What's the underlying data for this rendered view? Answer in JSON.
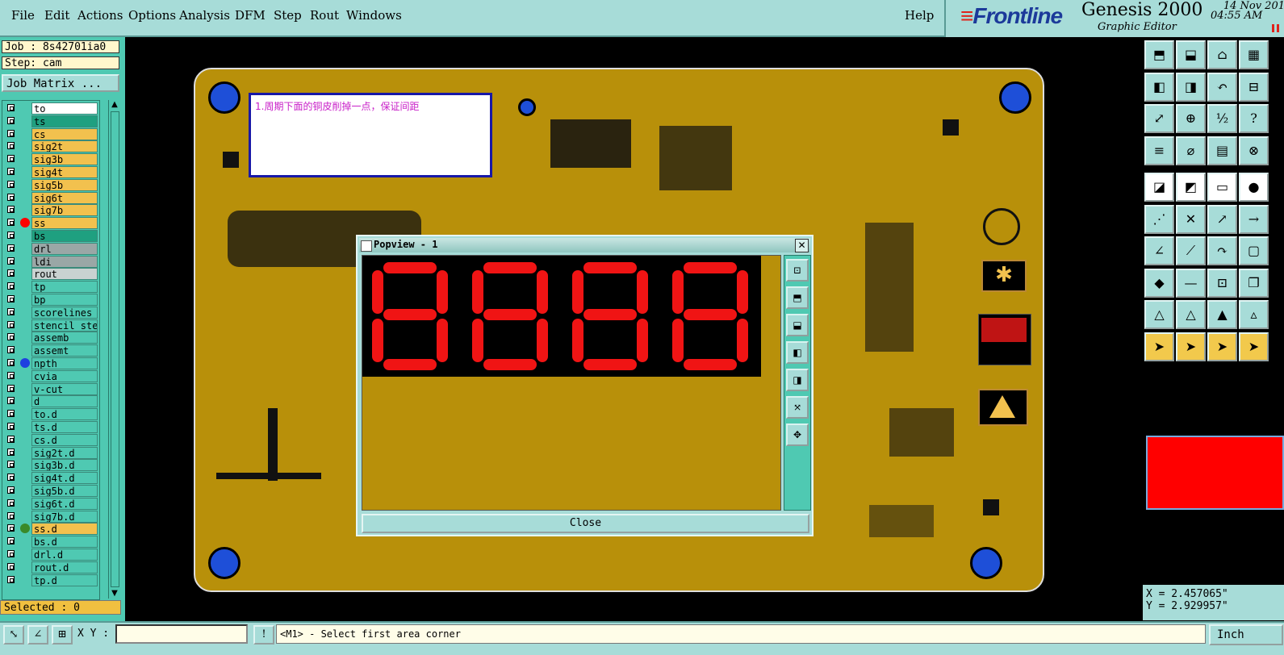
{
  "menu": [
    "File",
    "Edit",
    "Actions",
    "Options",
    "Analysis",
    "DFM",
    "Step",
    "Rout",
    "Windows"
  ],
  "help_label": "Help",
  "brand": {
    "logo": "Frontline",
    "product": "Genesis 2000",
    "subtitle": "Graphic Editor",
    "date": "14 Nov 201",
    "time": "04:55 AM"
  },
  "job": {
    "job_label": "Job : 8s42701ia0",
    "step_label": "Step: cam",
    "matrix_button": "Job Matrix ..."
  },
  "layers": [
    {
      "name": "to",
      "color": "#ffffff",
      "dot": ""
    },
    {
      "name": "ts",
      "color": "#1fa080",
      "dot": ""
    },
    {
      "name": "cs",
      "color": "#f2c14e",
      "dot": ""
    },
    {
      "name": "sig2t",
      "color": "#f2c14e",
      "dot": ""
    },
    {
      "name": "sig3b",
      "color": "#f2c14e",
      "dot": ""
    },
    {
      "name": "sig4t",
      "color": "#f2c14e",
      "dot": ""
    },
    {
      "name": "sig5b",
      "color": "#f2c14e",
      "dot": ""
    },
    {
      "name": "sig6t",
      "color": "#f2c14e",
      "dot": ""
    },
    {
      "name": "sig7b",
      "color": "#f2c14e",
      "dot": ""
    },
    {
      "name": "ss",
      "color": "#f2c14e",
      "dot": "#ff0000"
    },
    {
      "name": "bs",
      "color": "#1fa080",
      "dot": ""
    },
    {
      "name": "drl",
      "color": "#9aa7a6",
      "dot": ""
    },
    {
      "name": "ldi",
      "color": "#9aa7a6",
      "dot": ""
    },
    {
      "name": "rout",
      "color": "#c9d2d1",
      "dot": ""
    },
    {
      "name": "tp",
      "color": "#4fc9b2",
      "dot": ""
    },
    {
      "name": "bp",
      "color": "#4fc9b2",
      "dot": ""
    },
    {
      "name": "scorelines",
      "color": "#4fc9b2",
      "dot": ""
    },
    {
      "name": "stencil_ste",
      "color": "#4fc9b2",
      "dot": ""
    },
    {
      "name": "assemb",
      "color": "#4fc9b2",
      "dot": ""
    },
    {
      "name": "assemt",
      "color": "#4fc9b2",
      "dot": ""
    },
    {
      "name": "npth",
      "color": "#4fc9b2",
      "dot": "#1e3fe0"
    },
    {
      "name": "cvia",
      "color": "#4fc9b2",
      "dot": ""
    },
    {
      "name": "v-cut",
      "color": "#4fc9b2",
      "dot": ""
    },
    {
      "name": "d",
      "color": "#4fc9b2",
      "dot": ""
    },
    {
      "name": "to.d",
      "color": "#4fc9b2",
      "dot": ""
    },
    {
      "name": "ts.d",
      "color": "#4fc9b2",
      "dot": ""
    },
    {
      "name": "cs.d",
      "color": "#4fc9b2",
      "dot": ""
    },
    {
      "name": "sig2t.d",
      "color": "#4fc9b2",
      "dot": ""
    },
    {
      "name": "sig3b.d",
      "color": "#4fc9b2",
      "dot": ""
    },
    {
      "name": "sig4t.d",
      "color": "#4fc9b2",
      "dot": ""
    },
    {
      "name": "sig5b.d",
      "color": "#4fc9b2",
      "dot": ""
    },
    {
      "name": "sig6t.d",
      "color": "#4fc9b2",
      "dot": ""
    },
    {
      "name": "sig7b.d",
      "color": "#4fc9b2",
      "dot": ""
    },
    {
      "name": "ss.d",
      "color": "#f2c14e",
      "dot": "#3a8a2a"
    },
    {
      "name": "bs.d",
      "color": "#4fc9b2",
      "dot": ""
    },
    {
      "name": "drl.d",
      "color": "#4fc9b2",
      "dot": ""
    },
    {
      "name": "rout.d",
      "color": "#4fc9b2",
      "dot": ""
    },
    {
      "name": "tp.d",
      "color": "#4fc9b2",
      "dot": ""
    }
  ],
  "selected_label": "Selected : 0",
  "note_text": "1.周期下面的铜皮削掉一点，保证间距",
  "popview": {
    "title": "Popview - 1",
    "close_label": "Close",
    "digits": "8888"
  },
  "coords": {
    "x": "X = 2.457065\"",
    "y": "Y = 2.929957\""
  },
  "status": {
    "xy_label": "X Y :",
    "xy_value": "",
    "prompt": "<M1> - Select first area corner",
    "units": "Inch"
  },
  "colors": {
    "panel": "#a7dcd8",
    "layer_bg": "#4fc9b2",
    "board": "#b8900a",
    "highlight": "#ff0000"
  },
  "right_toolbar_icons": [
    "zoom-home-icon",
    "zoom-page-icon",
    "home-icon",
    "grid-icon",
    "pan-left-icon",
    "pan-right-icon",
    "undo-zoom-icon",
    "zoom-out-icon",
    "fit-icon",
    "zoom-in-icon",
    "one-to-two-icon",
    "help-icon",
    "measure-icon",
    "snap-icon",
    "layers-icon",
    "net-icon",
    "select-feature-icon",
    "select-net-icon",
    "ruler-icon",
    "dot-icon",
    "connect-icon",
    "cross-icon",
    "arrow-up-icon",
    "arrow-right-icon",
    "line-icon",
    "angle-icon",
    "arc-icon",
    "area-icon",
    "pad-icon",
    "minus-icon",
    "zoom-window-icon",
    "copy-icon",
    "triangle-icon",
    "triangle-text-icon",
    "triangle-up-icon",
    "triangle-node-icon",
    "pointer-icon",
    "pointer-box-icon",
    "pointer-corner-icon",
    "pointer-net-icon"
  ]
}
